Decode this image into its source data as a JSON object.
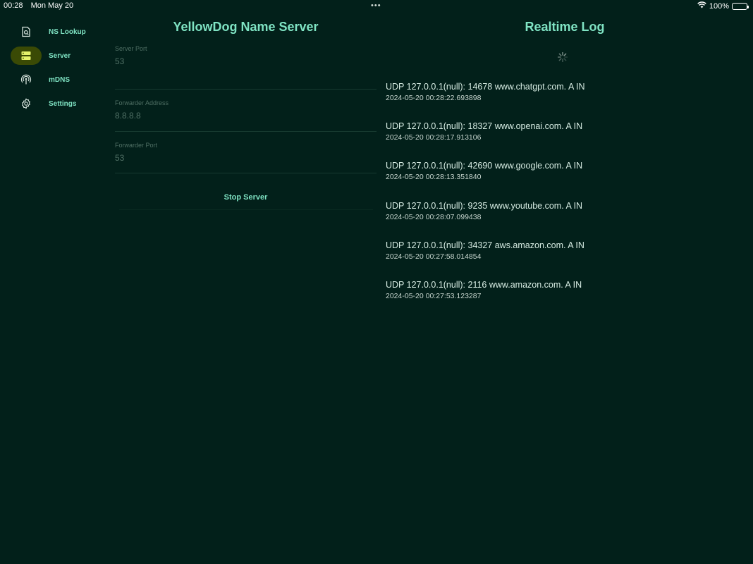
{
  "status_bar": {
    "time": "00:28",
    "date": "Mon May 20",
    "multitask": "•••",
    "battery": "100%",
    "battery_level": 1.0
  },
  "sidebar": {
    "items": [
      {
        "label": "NS Lookup",
        "icon": "doc-search-icon",
        "active": false
      },
      {
        "label": "Server",
        "icon": "server-icon",
        "active": true
      },
      {
        "label": "mDNS",
        "icon": "broadcast-icon",
        "active": false
      },
      {
        "label": "Settings",
        "icon": "gear-icon",
        "active": false
      }
    ]
  },
  "server_panel": {
    "title": "YellowDog Name Server",
    "fields": [
      {
        "label": "Server Port",
        "value": "53"
      },
      {
        "label": "Forwarder Address",
        "value": "8.8.8.8"
      },
      {
        "label": "Forwarder Port",
        "value": "53"
      }
    ],
    "stop_button": "Stop Server"
  },
  "log_panel": {
    "title": "Realtime Log",
    "entries": [
      {
        "line": "UDP 127.0.0.1(null): 14678 www.chatgpt.com. A IN",
        "time": "2024-05-20 00:28:22.693898"
      },
      {
        "line": "UDP 127.0.0.1(null): 18327 www.openai.com. A IN",
        "time": "2024-05-20 00:28:17.913106"
      },
      {
        "line": "UDP 127.0.0.1(null): 42690 www.google.com. A IN",
        "time": "2024-05-20 00:28:13.351840"
      },
      {
        "line": "UDP 127.0.0.1(null): 9235 www.youtube.com. A IN",
        "time": "2024-05-20 00:28:07.099438"
      },
      {
        "line": "UDP 127.0.0.1(null): 34327 aws.amazon.com. A IN",
        "time": "2024-05-20 00:27:58.014854"
      },
      {
        "line": "UDP 127.0.0.1(null): 2116 www.amazon.com. A IN",
        "time": "2024-05-20 00:27:53.123287"
      }
    ]
  },
  "colors": {
    "background": "#02201a",
    "accent": "#7fe3c3",
    "active_pill": "#3a4a05",
    "active_icon": "#e3f26a"
  }
}
